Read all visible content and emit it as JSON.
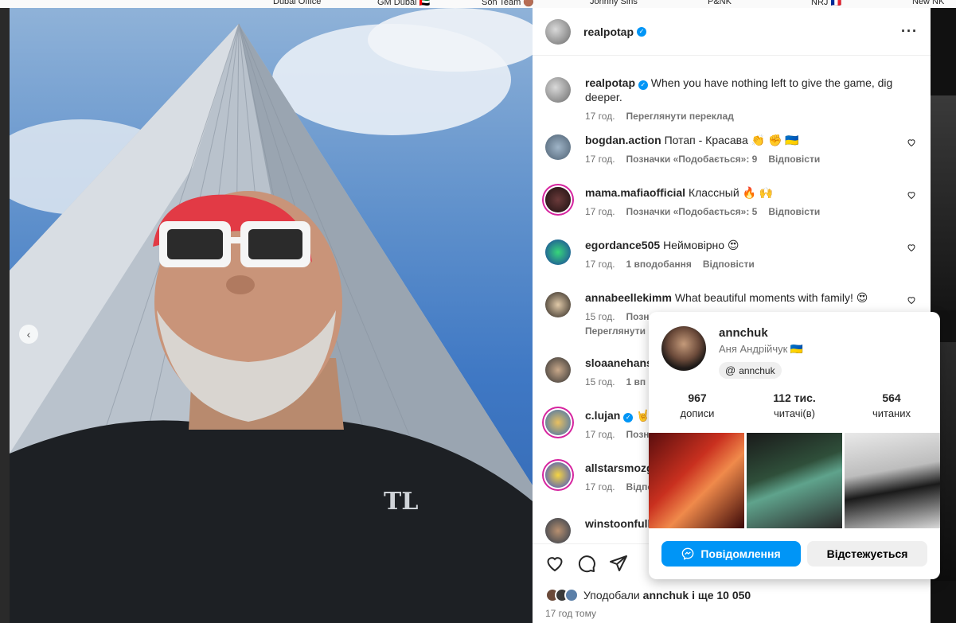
{
  "background_page": {
    "story_labels": [
      "Dubai Office",
      "GM Dubai 🇦🇪",
      "Son Team 🟤",
      "Johnny Sins",
      "P&NK",
      "NRJ 🇫🇷",
      "New NK"
    ]
  },
  "post": {
    "username": "realpotap",
    "caption": "When you have nothing left to give the game, dig deeper.",
    "caption_time": "17 год.",
    "translate_label": "Переглянути переклад",
    "comments": [
      {
        "username": "bogdan.action",
        "text": "Потап - Красава 👏 ✊ 🇺🇦",
        "time": "17 год.",
        "likes": "Позначки «Подобається»: 9",
        "reply": "Відповісти",
        "verified": false
      },
      {
        "username": "mama.mafiaofficial",
        "text": "Классный 🔥 🙌",
        "time": "17 год.",
        "likes": "Позначки «Подобається»: 5",
        "reply": "Відповісти",
        "verified": false
      },
      {
        "username": "egordance505",
        "text": "Неймовірно 😍",
        "time": "17 год.",
        "likes": "1 вподобання",
        "reply": "Відповісти",
        "verified": false
      },
      {
        "username": "annabeellekimm",
        "text": "What beautiful moments with family! 😍",
        "time": "15 год.",
        "likes": "Позн",
        "reply": "",
        "extra": "Переглянути п",
        "verified": false
      },
      {
        "username": "sloaanehansc",
        "text": "",
        "time": "15 год.",
        "likes": "1 вп",
        "reply": "",
        "verified": false
      },
      {
        "username": "c.lujan",
        "text": "🤘",
        "time": "17 год.",
        "likes": "Позна",
        "reply": "",
        "verified": true
      },
      {
        "username": "allstarsmozg",
        "text": "",
        "time": "17 год.",
        "likes": "Відпо",
        "reply": "",
        "verified": false
      },
      {
        "username": "winstoonfull",
        "text": "",
        "time": "",
        "likes": "",
        "reply": "",
        "verified": false
      }
    ],
    "liked_by_prefix": "Уподобали",
    "liked_by_user": "annchuk",
    "liked_by_suffix": "і ще 10 050",
    "posted_ago": "17 год тому"
  },
  "hovercard": {
    "username": "annchuk",
    "full_name": "Аня Андрійчук 🇺🇦",
    "threads_handle": "annchuk",
    "stats": [
      {
        "value": "967",
        "label": "дописи"
      },
      {
        "value": "112 тис.",
        "label": "читачі(в)"
      },
      {
        "value": "564",
        "label": "читаних"
      }
    ],
    "message_button": "Повідомлення",
    "following_button": "Відстежується"
  },
  "colors": {
    "accent": "#0095f6",
    "text": "#262626",
    "secondary_text": "#737373"
  }
}
